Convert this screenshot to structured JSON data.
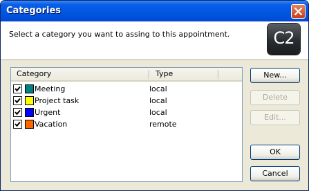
{
  "window": {
    "title": "Categories"
  },
  "header": {
    "prompt": "Select a category you want to assing to this appointment.",
    "logo_text": "C2"
  },
  "list": {
    "columns": {
      "category": "Category",
      "type": "Type"
    },
    "rows": [
      {
        "checked": true,
        "color": "#008080",
        "name": "Meeting",
        "type": "local"
      },
      {
        "checked": true,
        "color": "#ffff00",
        "name": "Project task",
        "type": "local"
      },
      {
        "checked": true,
        "color": "#0000ff",
        "name": "Urgent",
        "type": "local"
      },
      {
        "checked": true,
        "color": "#ff6600",
        "name": "Vacation",
        "type": "remote"
      }
    ]
  },
  "buttons": {
    "new": "New...",
    "delete": "Delete",
    "edit": "Edit...",
    "ok": "OK",
    "cancel": "Cancel"
  }
}
